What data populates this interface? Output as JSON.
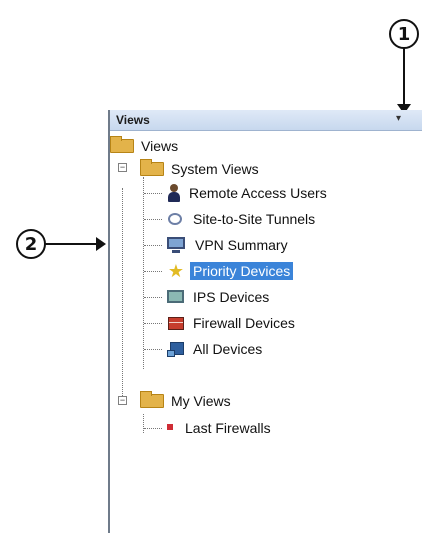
{
  "callouts": [
    "1",
    "2"
  ],
  "panel": {
    "title": "Views",
    "caret": "▾"
  },
  "tree": {
    "root_label": "Views",
    "system_views": {
      "label": "System Views",
      "expander": "−",
      "items": [
        {
          "label": "Remote Access Users",
          "icon": "user-icon"
        },
        {
          "label": "Site-to-Site Tunnels",
          "icon": "tunnel-icon"
        },
        {
          "label": "VPN Summary",
          "icon": "monitor-icon"
        },
        {
          "label": "Priority Devices",
          "icon": "star-icon",
          "selected": true
        },
        {
          "label": "IPS Devices",
          "icon": "ips-icon"
        },
        {
          "label": "Firewall Devices",
          "icon": "firewall-icon"
        },
        {
          "label": "All Devices",
          "icon": "devices-icon"
        }
      ]
    },
    "my_views": {
      "label": "My Views",
      "expander": "−",
      "items": [
        {
          "label": "Last Firewalls",
          "icon": "firewall-mini-icon"
        }
      ]
    }
  },
  "colors": {
    "selection": "#3b84d9",
    "header_top": "#dfe9f7",
    "header_bottom": "#c7d8ee"
  }
}
